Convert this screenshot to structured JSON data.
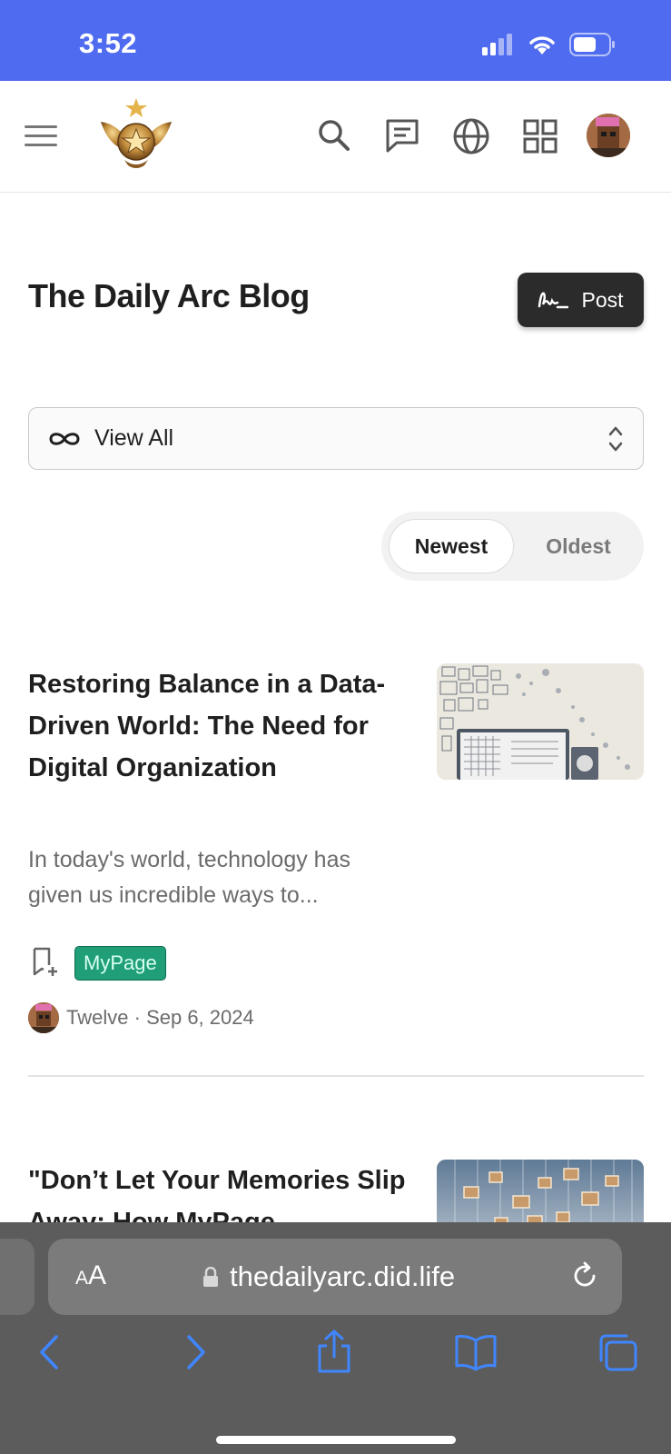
{
  "status_bar": {
    "time": "3:52",
    "background": "#4f6bef"
  },
  "header": {
    "menu_icon": "hamburger-menu-icon",
    "logo_icon": "eagle-star-emblem-logo",
    "icons": [
      "search-icon",
      "chat-icon",
      "globe-icon",
      "apps-grid-icon",
      "avatar"
    ]
  },
  "page": {
    "title": "The Daily Arc Blog",
    "post_button_label": "Post"
  },
  "filter": {
    "selected": "View All"
  },
  "sort": {
    "newest_label": "Newest",
    "oldest_label": "Oldest",
    "active": "Newest"
  },
  "articles": [
    {
      "title": "Restoring Balance in a Data-Driven World: The Need for Digital Organization",
      "excerpt": "In today's world, technology has given us incredible ways to...",
      "tag": "MyPage",
      "author": "Twelve",
      "separator": "·",
      "date": "Sep 6, 2024"
    },
    {
      "title": "\"Don’t Let Your Memories Slip Away: How MyPage"
    }
  ],
  "browser": {
    "aa_label_small": "A",
    "aa_label_large": "A",
    "url": "thedailyarc.did.life",
    "accent": "#3f86ff"
  }
}
